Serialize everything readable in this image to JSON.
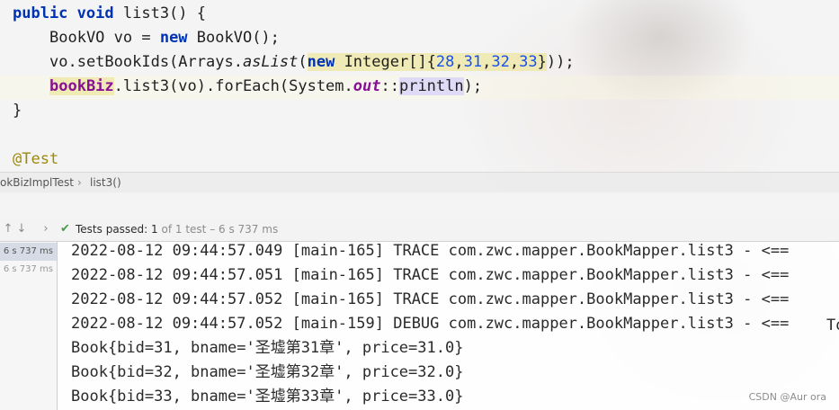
{
  "editor": {
    "line1": {
      "kw1": "public",
      "kw2": "void",
      "rest": "list3() {"
    },
    "line2": {
      "type": "BookVO vo = ",
      "kw": "new",
      "rest": " BookVO();"
    },
    "line3": {
      "pre": "vo.setBookIds(Arrays.",
      "method": "asList",
      "paren": "(",
      "kw": "new",
      "mid": " Integer[]{",
      "n1": "28",
      "c1": ",",
      "n2": "31",
      "c2": ",",
      "n3": "32",
      "c3": ",",
      "n4": "33",
      "close": "}",
      "end": "));"
    },
    "line4": {
      "field": "bookBiz",
      "mid": ".list3(vo).forEach(System.",
      "static_field": "out",
      "ref": "::",
      "method": "println",
      "end": ");"
    },
    "line5": "}",
    "line6": "@Test"
  },
  "breadcrumb": {
    "items": [
      "okBizImplTest",
      "list3()"
    ],
    "separator": "›"
  },
  "toolbar": {
    "up_icon": "arrow-up-icon",
    "down_icon": "arrow-down-icon",
    "check_icon": "check-icon",
    "passed_label": "Tests passed:",
    "passed_count": "1",
    "rest": "of 1 test – 6 s 737 ms"
  },
  "tree": {
    "rows": [
      {
        "time": "6 s 737 ms",
        "selected": true
      },
      {
        "time": "6 s 737 ms",
        "selected": false
      }
    ]
  },
  "console": {
    "lines": [
      "2022-08-12 09:44:57.049 [main-165] TRACE com.zwc.mapper.BookMapper.list3 - <==",
      "2022-08-12 09:44:57.051 [main-165] TRACE com.zwc.mapper.BookMapper.list3 - <==",
      "2022-08-12 09:44:57.052 [main-165] TRACE com.zwc.mapper.BookMapper.list3 - <==",
      "2022-08-12 09:44:57.052 [main-159] DEBUG com.zwc.mapper.BookMapper.list3 - <==",
      "Book{bid=31, bname='圣墟第31章', price=31.0}",
      "Book{bid=32, bname='圣墟第32章', price=32.0}",
      "Book{bid=33, bname='圣墟第33章', price=33.0}"
    ],
    "tail": "To"
  },
  "watermark": "CSDN @Aur ora",
  "colors": {
    "keyword": "#0033b3",
    "number": "#1750eb",
    "field": "#871094",
    "annotation": "#9e880d",
    "pass": "#4a9c4a"
  }
}
